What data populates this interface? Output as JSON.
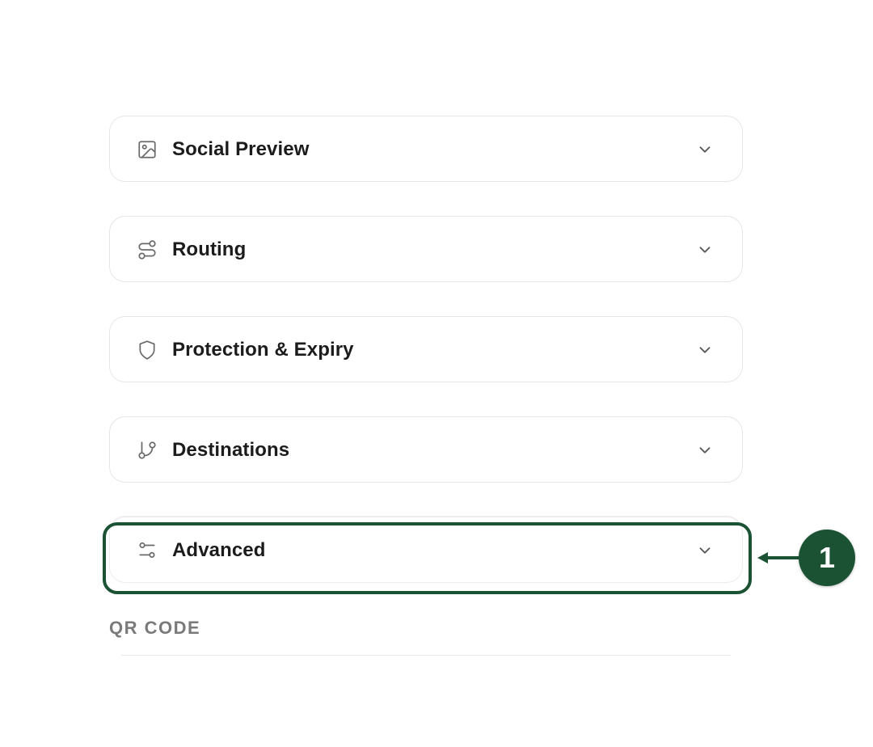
{
  "panels": [
    {
      "label": "Social Preview",
      "icon": "image-icon"
    },
    {
      "label": "Routing",
      "icon": "route-icon"
    },
    {
      "label": "Protection & Expiry",
      "icon": "shield-icon"
    },
    {
      "label": "Destinations",
      "icon": "git-branch-icon"
    },
    {
      "label": "Advanced",
      "icon": "sliders-icon"
    }
  ],
  "section": {
    "title": "QR CODE"
  },
  "callout": {
    "number": "1",
    "color": "#1b5234"
  }
}
